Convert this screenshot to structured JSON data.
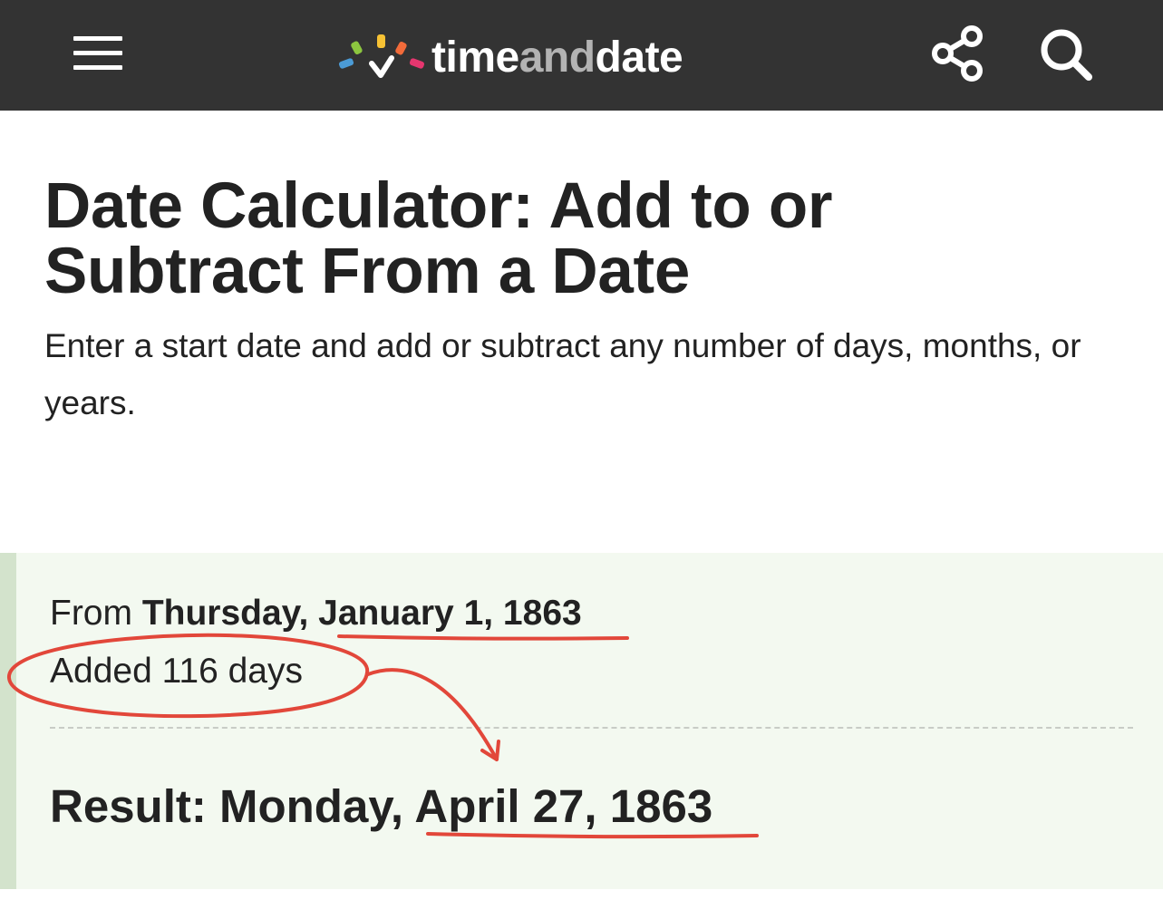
{
  "header": {
    "menu_icon": "hamburger-menu-icon",
    "logo": {
      "part1": "time",
      "part2": "and",
      "part3": "date",
      "mark_colors": [
        "#4b9bd6",
        "#8cc63f",
        "#f7c234",
        "#f26b3a",
        "#e6366f"
      ]
    },
    "share_icon": "share-icon",
    "search_icon": "search-icon"
  },
  "page": {
    "title": "Date Calculator: Add to or Subtract From a Date",
    "intro": "Enter a start date and add or subtract any number of days, months, or years."
  },
  "result": {
    "from_prefix": "From ",
    "from_weekday": "Thursday, ",
    "from_date": "January 1, 1863",
    "added": "Added 116 days",
    "result_prefix": "Result: Monday, ",
    "result_date": "April 27, 1863",
    "box_color": "#f3f9f0",
    "accent_color": "#d3e3cc"
  },
  "annotation": {
    "ink_color": "#e2473a"
  }
}
